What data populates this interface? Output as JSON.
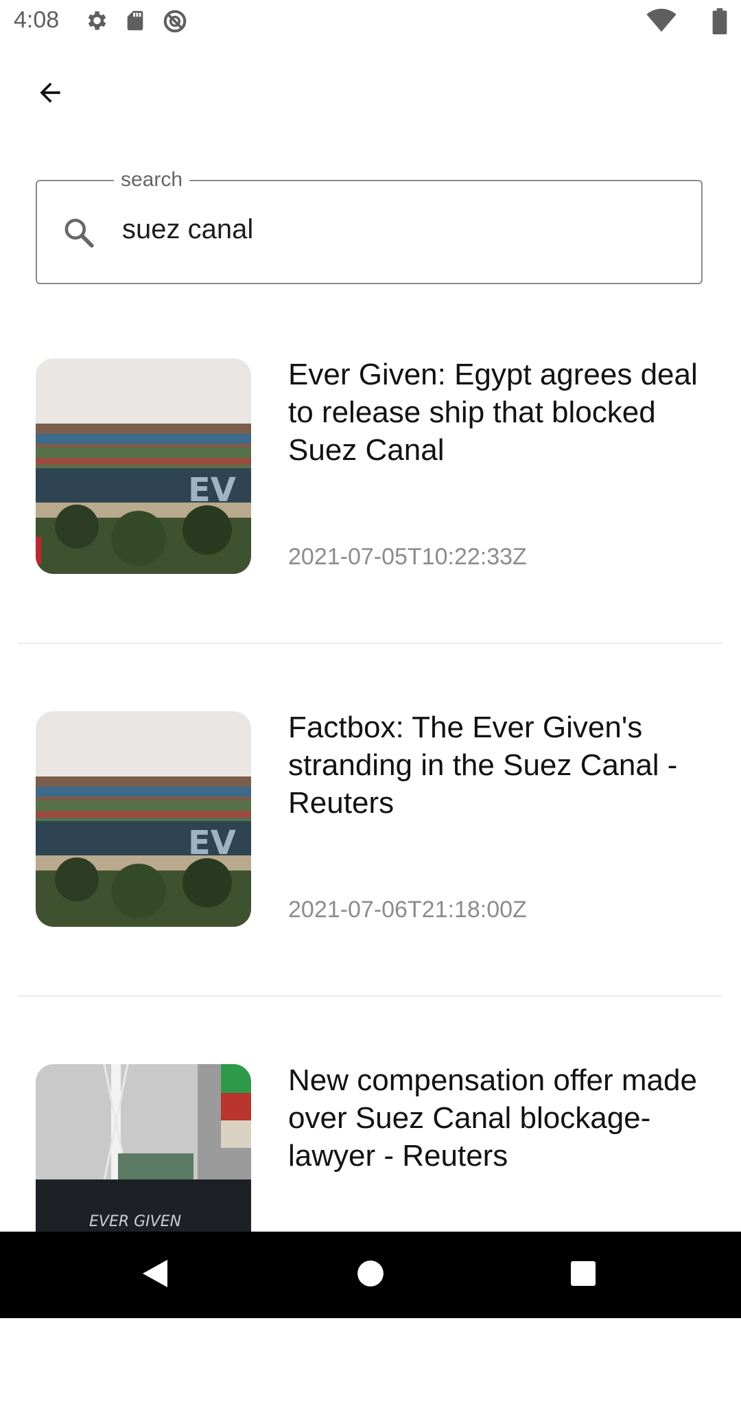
{
  "status_bar": {
    "time": "4:08",
    "left_icons": [
      "settings-icon",
      "sd-card-icon",
      "do-not-disturb-icon"
    ],
    "right_icons": [
      "wifi-icon",
      "battery-icon"
    ]
  },
  "header": {
    "back_icon": "arrow-back-icon"
  },
  "search": {
    "label": "search",
    "value": "suez canal",
    "icon": "search-icon"
  },
  "articles": [
    {
      "title": "Ever Given: Egypt agrees deal to release ship that blocked Suez Canal",
      "date": "2021-07-05T10:22:33Z"
    },
    {
      "title": "Factbox: The Ever Given's stranding in the Suez Canal - Reuters",
      "date": "2021-07-06T21:18:00Z"
    },
    {
      "title": "New compensation offer made over Suez Canal blockage- lawyer - Reuters",
      "date": "",
      "thumb_text": "EVER GIVEN"
    }
  ],
  "nav_bar": {
    "icons": [
      "back-triangle-icon",
      "home-circle-icon",
      "recents-square-icon"
    ]
  },
  "colors": {
    "background": "#ffffff",
    "title": "#121212",
    "date": "#8c8c8c",
    "nav": "#000000"
  }
}
